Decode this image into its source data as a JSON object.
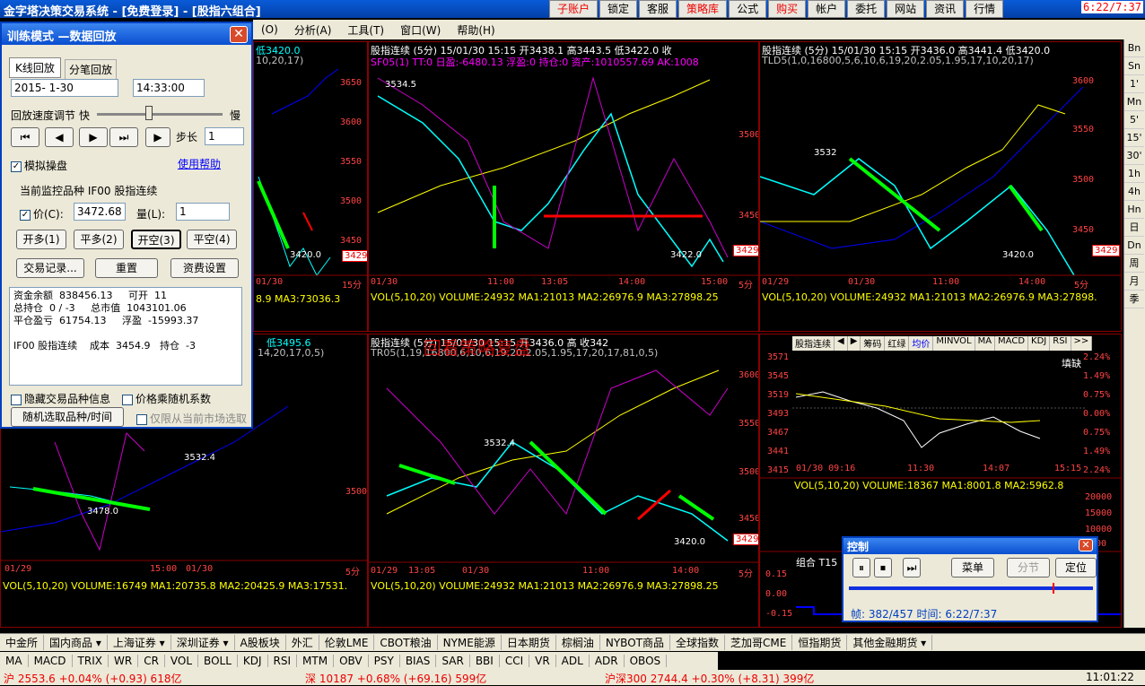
{
  "window": {
    "title": "金字塔决策交易系统 - [免费登录] - [股指六组合]",
    "clock": "6:22/7:37"
  },
  "top_buttons": [
    {
      "label": "子账户",
      "red": true
    },
    {
      "label": "锁定",
      "red": false
    },
    {
      "label": "客服",
      "red": false
    },
    {
      "label": "策略库",
      "red": true
    },
    {
      "label": "公式",
      "red": false
    },
    {
      "label": "购买",
      "red": true
    },
    {
      "label": "帐户",
      "red": false
    },
    {
      "label": "委托",
      "red": false
    },
    {
      "label": "网站",
      "red": false
    },
    {
      "label": "资讯",
      "red": false
    },
    {
      "label": "行情",
      "red": false
    }
  ],
  "menu": [
    "(O)",
    "分析(A)",
    "工具(T)",
    "窗口(W)",
    "帮助(H)"
  ],
  "dialog": {
    "title": "训练模式 —数据回放",
    "tabs": [
      "K线回放",
      "分笔回放"
    ],
    "date": "2015- 1-30",
    "time": "14:33:00",
    "speed_label": "回放速度调节",
    "fast": "快",
    "slow": "慢",
    "step_label": "步长",
    "step_value": "1",
    "simulate_label": "模拟操盘",
    "help_link": "使用帮助",
    "monitor_label": "当前监控品种  IF00  股指连续",
    "price_label": "价(C):",
    "price_value": "3472.68",
    "qty_label": "量(L):",
    "qty_value": "1",
    "trade_buttons": [
      "开多(1)",
      "平多(2)",
      "开空(3)",
      "平空(4)"
    ],
    "bottom_buttons": [
      "交易记录...",
      "重置",
      "资费设置"
    ],
    "account_lines": [
      "资金余额  838456.13     可开  11",
      "总持仓  0 / -3     总市值  1043101.06",
      "平仓盈亏  61754.13     浮盈  -15993.37",
      "",
      "IF00 股指连续    成本  3454.9   持仓  -3"
    ],
    "hide_info": "隐藏交易品种信息",
    "random_coef": "价格乘随机系数",
    "random_pick": "随机选取品种/时间",
    "current_only": "仅限从当前市场选取"
  },
  "panels": {
    "p1": {
      "title_parts": [
        "O",
        " 低3420.0"
      ],
      "sub": "10,20,17)",
      "price_tag": "3429",
      "ticks": [
        "3650",
        "3600",
        "3550",
        "3500",
        "3450"
      ],
      "low_label": "3420.0",
      "dates": [
        "01/30",
        "15分"
      ],
      "vol": "8.9  MA3:73036.3"
    },
    "p2": {
      "title": "股指连续  (5分)  15/01/30 15:15  开3438.1  高3443.5  低3422.0  收",
      "sub": "SF05(1)  TT:0  日盈:-6480.13  浮盈:0  持仓:0  资产:1010557.69  AK:1008",
      "high_label": "3534.5",
      "low_label": "3422.0",
      "price_tag": "3429",
      "ticks": [
        "3500",
        "3450"
      ],
      "dates": [
        "01/30",
        "11:00",
        "13:05",
        "14:00",
        "15:00",
        "5分"
      ],
      "vol": "VOL(5,10,20)  VOLUME:24932  MA1:21013  MA2:26976.9  MA3:27898.25"
    },
    "p3": {
      "title": "股指连续  (5分)  15/01/30 15:15  开3436.0  高3441.4  低3420.0",
      "sub": "TLD5(1,0,16800,5,6,10,6,19,20,2.05,1.95,17,10,20,17)",
      "mid_label": "3532",
      "low_label": "3420.0",
      "price_tag": "3429",
      "ticks": [
        "3600",
        "3550",
        "3500",
        "3450"
      ],
      "dates": [
        "01/29",
        "01/30",
        "11:00",
        "14:00",
        "5分"
      ],
      "vol": "VOL(5,10,20)  VOLUME:24932  MA1:21013  MA2:26976.9  MA3:27898."
    },
    "p4": {
      "title": "低3495.6",
      "sub": "14,20,17,0,5)",
      "mid_label": "3532.4",
      "low_label": "3478.0",
      "ticks": [
        "3500"
      ],
      "dates": [
        "01/29",
        "15:00",
        "01/30",
        "5分"
      ],
      "vol": "VOL(5,10,20)  VOLUME:16749  MA1:20735.8  MA2:20425.9  MA3:17531."
    },
    "p5": {
      "title": "股指连续  (5分)  15/01/30 15:15  开3436.0  高  收342",
      "sub": "TR05(1,19,16800,6,10,6,19,20,2.05,1.95,17,20,17,81,0,5)",
      "mid_label": "3532.4",
      "low_label": "3420.0",
      "price_tag": "3429",
      "ticks": [
        "3600",
        "3550",
        "3500",
        "3450"
      ],
      "dates": [
        "01/29",
        "13:05",
        "01/30",
        "11:00",
        "14:00",
        "5分"
      ],
      "vol": "VOL(5,10,20)  VOLUME:24932  MA1:21013  MA2:26976.9  MA3:27898.25"
    },
    "p6": {
      "tabs": [
        "股指连续",
        "◀",
        "▶",
        "筹码",
        "红绿",
        "均价",
        "MINVOL",
        "MA",
        "MACD",
        "KDJ",
        "RSI",
        ">>"
      ],
      "fill_label": "填缺",
      "left_ticks": [
        "3571",
        "3545",
        "3519",
        "3493",
        "3467",
        "3441",
        "3415"
      ],
      "right_ticks": [
        "2.24%",
        "1.49%",
        "0.75%",
        "0.00%",
        "0.75%",
        "1.49%",
        "2.24%"
      ],
      "dates": [
        "01/30 09:16",
        "11:30",
        "14:07",
        "15:15"
      ],
      "vol": "VOL(5,10,20)  VOLUME:18367  MA1:8001.8  MA2:5962.8",
      "vol_ticks": [
        "20000",
        "15000",
        "10000",
        "5000"
      ],
      "bottom_ticks": [
        "0.15",
        "0.00",
        "-0.15"
      ],
      "bottom_label": "组合  T15"
    }
  },
  "watermark": "回看策略复盘",
  "control": {
    "title": "控制",
    "buttons": [
      "菜单",
      "分节",
      "定位"
    ],
    "frame_text": "帧: 382/457  时间: 6:22/7:37",
    "progress": 0.836
  },
  "right_sidebar": [
    "Bn",
    "Sn",
    "1'",
    "Mn",
    "5'",
    "15'",
    "30'",
    "1h",
    "4h",
    "Hn",
    "日",
    "Dn",
    "周",
    "月",
    "季"
  ],
  "market_tabs": [
    "中金所",
    "国内商品 ▾",
    "上海证券 ▾",
    "深圳证券 ▾",
    "A股板块",
    "外汇",
    "伦敦LME",
    "CBOT粮油",
    "NYME能源",
    "日本期货",
    "棕榈油",
    "NYBOT商品",
    "全球指数",
    "芝加哥CME",
    "恒指期货",
    "其他金融期货 ▾"
  ],
  "indicator_tabs": [
    "MA",
    "MACD",
    "TRIX",
    "WR",
    "CR",
    "VOL",
    "BOLL",
    "KDJ",
    "RSI",
    "MTM",
    "OBV",
    "PSY",
    "BIAS",
    "SAR",
    "BBI",
    "CCI",
    "VR",
    "ADL",
    "ADR",
    "OBOS"
  ],
  "status": {
    "sh": "沪  2553.6  +0.04%  (+0.93)  618亿",
    "sz": "深  10187  +0.68%  (+69.16)  599亿",
    "hs300": "沪深300  2744.4  +0.30%  (+8.31)  399亿",
    "time": "11:01:22"
  }
}
